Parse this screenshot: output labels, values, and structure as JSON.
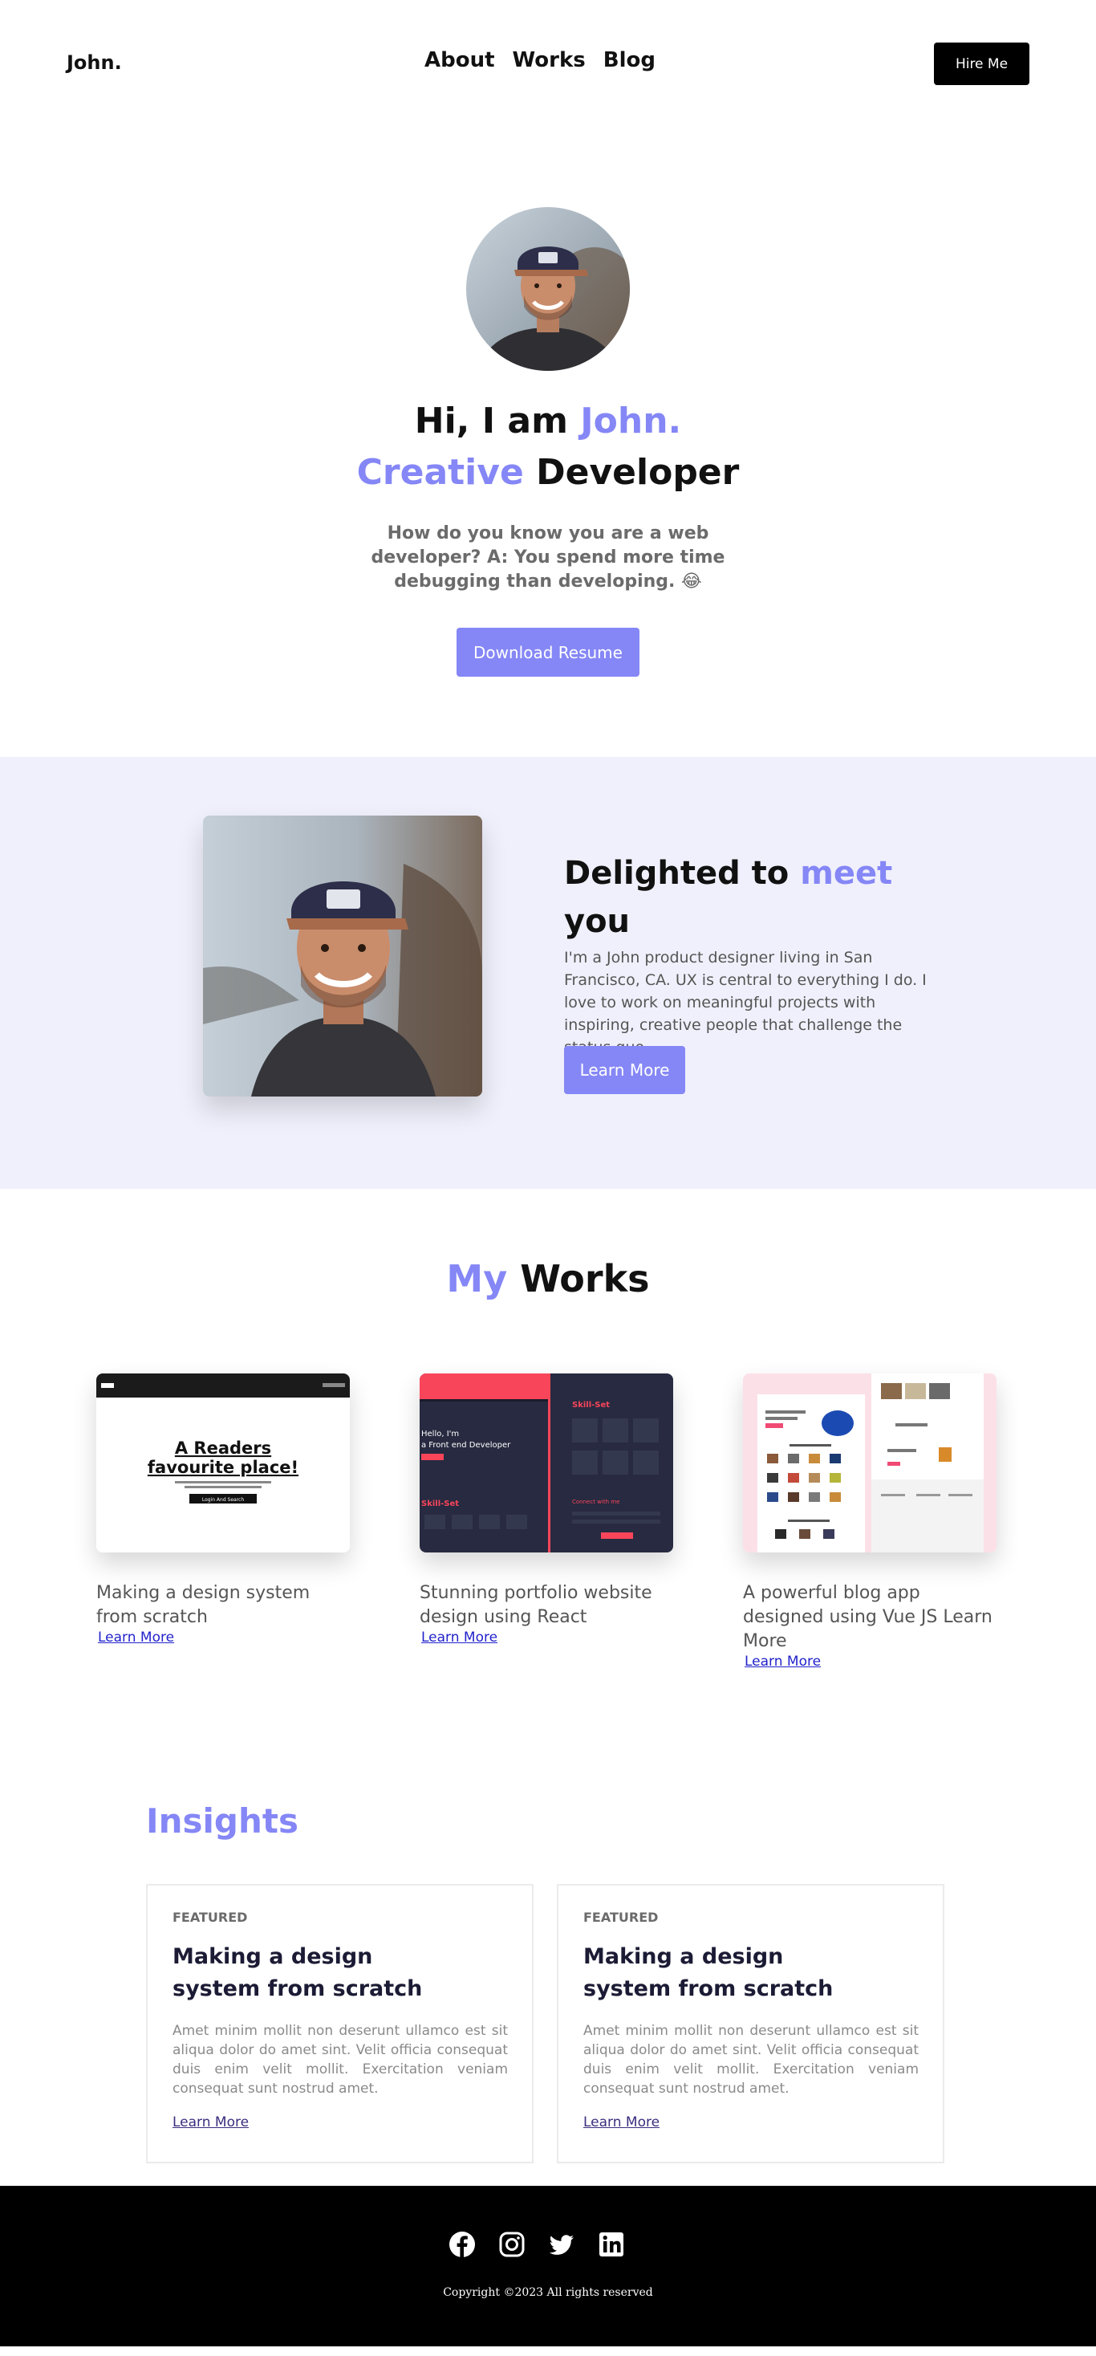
{
  "header": {
    "logo": "John.",
    "nav": [
      "About",
      "Works",
      "Blog"
    ],
    "hire_label": "Hire Me"
  },
  "hero": {
    "greeting": "Hi, I am ",
    "name": "John.",
    "role_accent": "Creative",
    "role_rest": " Developer",
    "joke": "How do you know you are a web developer? A: You spend more time debugging than developing. 😂",
    "download_label": "Download Resume"
  },
  "about": {
    "title_part1": "Delighted to ",
    "title_accent": "meet",
    "title_part2": "you",
    "text": "I'm a John product designer living in San Francisco, CA. UX is central to everything I do. I love to work on meaningful projects with inspiring, creative people that challenge the status quo.",
    "button_label": "Learn More"
  },
  "works": {
    "title_accent": "My",
    "title_rest": " Works",
    "items": [
      {
        "description": "Making a design system from scratch",
        "link_label": "Learn More",
        "thumb_heading_line1": "A Readers",
        "thumb_heading_line2": "favourite place!",
        "thumb_button": "Login And Search"
      },
      {
        "description": "Stunning portfolio website design using React",
        "link_label": "Learn More",
        "thumb_line1": "Hello, I'm",
        "thumb_line2": "a Front end Developer",
        "thumb_label1": "Skill-Set",
        "thumb_label2": "Skill-Set",
        "thumb_label3": "Connect with me"
      },
      {
        "description": "A powerful blog app designed using Vue JS Learn More",
        "link_label": "Learn More"
      }
    ]
  },
  "insights": {
    "title": "Insights",
    "cards": [
      {
        "tag": "FEATURED",
        "title": "Making a design system from scratch",
        "body": "Amet minim mollit non deserunt ullamco est sit aliqua dolor do amet sint. Velit officia consequat duis enim velit mollit. Exercitation veniam consequat sunt nostrud amet.",
        "link_label": "Learn More"
      },
      {
        "tag": "FEATURED",
        "title": "Making a design system from scratch",
        "body": "Amet minim mollit non deserunt ullamco est sit aliqua dolor do amet sint. Velit officia consequat duis enim velit mollit. Exercitation veniam consequat sunt nostrud amet.",
        "link_label": "Learn More"
      }
    ]
  },
  "footer": {
    "socials": [
      "facebook-icon",
      "instagram-icon",
      "twitter-icon",
      "linkedin-icon"
    ],
    "copyright": "Copyright ©2023 All rights reserved"
  },
  "colors": {
    "accent": "#8587f6",
    "about_bg": "#f0f0fc",
    "footer_bg": "#000000",
    "react_red": "#f8455a",
    "react_navy": "#272a40",
    "vue_pink": "#fce0e8"
  }
}
